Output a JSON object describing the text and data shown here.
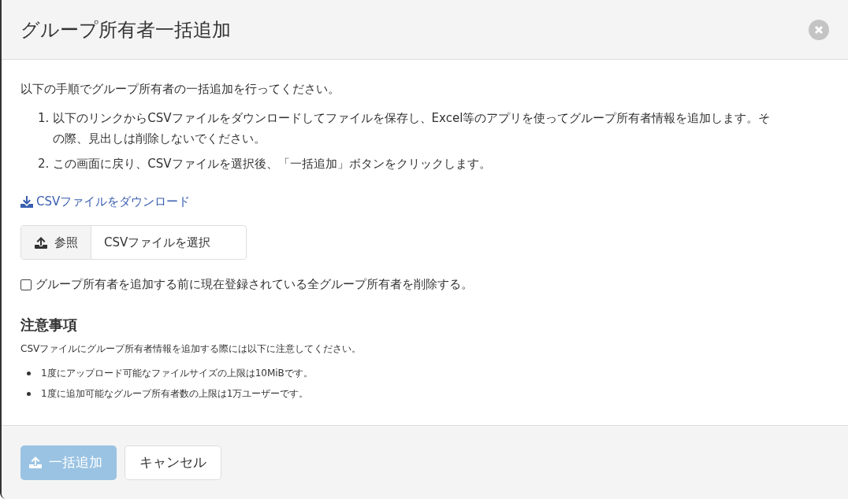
{
  "dialog": {
    "title": "グループ所有者一括追加"
  },
  "intro": "以下の手順でグループ所有者の一括追加を行ってください。",
  "steps": [
    {
      "number": "1.",
      "text": "以下のリンクからCSVファイルをダウンロードしてファイルを保存し、Excel等のアプリを使ってグループ所有者情報を追加します。その際、見出しは削除しないでください。"
    },
    {
      "number": "2.",
      "text": "この画面に戻り、CSVファイルを選択後、「一括追加」ボタンをクリックします。"
    }
  ],
  "download_link": "CSVファイルをダウンロード",
  "file_input": {
    "button": "参照",
    "placeholder": "CSVファイルを選択"
  },
  "delete_option": {
    "label": "グループ所有者を追加する前に現在登録されている全グループ所有者を削除する。",
    "checked": false
  },
  "notes": {
    "heading": "注意事項",
    "text": "CSVファイルにグループ所有者情報を追加する際には以下に注意してください。",
    "items": [
      "1度にアップロード可能なファイルサイズの上限は10MiBです。",
      "1度に追加可能なグループ所有者数の上限は1万ユーザーです。"
    ]
  },
  "footer": {
    "submit": {
      "label": "一括追加",
      "disabled": true
    },
    "cancel": "キャンセル"
  }
}
